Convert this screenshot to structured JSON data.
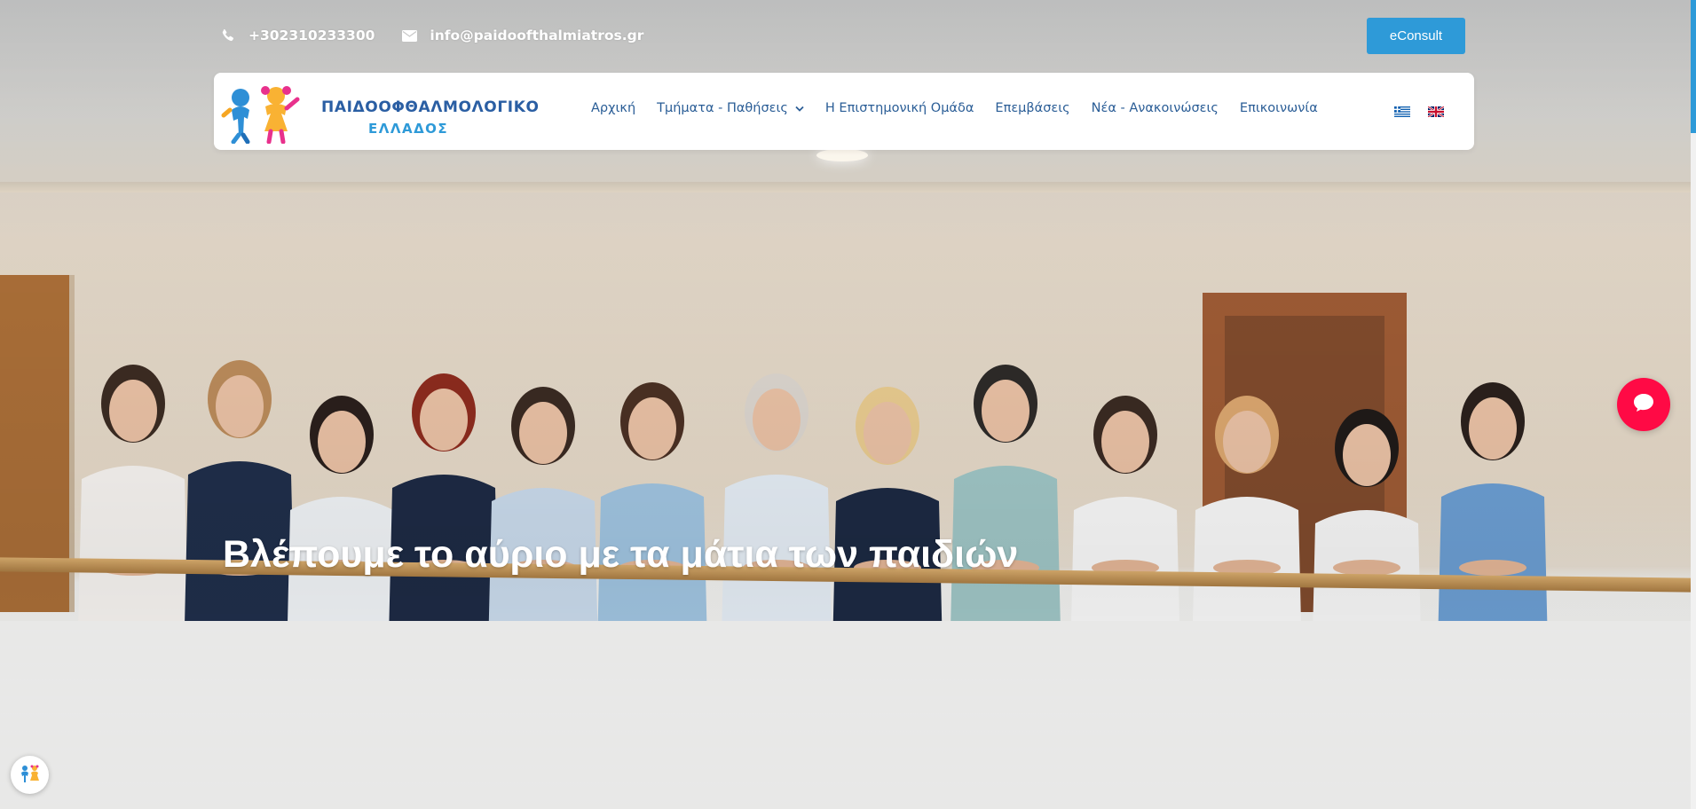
{
  "contact": {
    "phone": "+302310233300",
    "phone_icon": "phone-icon",
    "email": "info@paidoofthalmiatros.gr",
    "email_icon": "envelope-icon"
  },
  "econsult_button": {
    "label": "eConsult",
    "color": "#2e9ad8"
  },
  "logo": {
    "title": "ΠΑΙΔΟΟΦΘΑΛΜΟΛΟΓΙΚΟ",
    "subtitle": "ΕΛΛΑΔΟΣ",
    "title_color": "#2a5ea3",
    "subtitle_color": "#2e9ad8"
  },
  "nav": {
    "items": [
      {
        "label": "Αρχική"
      },
      {
        "label": "Τμήματα - Παθήσεις",
        "has_dropdown": true,
        "icon": "chevron-down-icon"
      },
      {
        "label": "Η Επιστημονική Ομάδα"
      },
      {
        "label": "Επεμβάσεις"
      },
      {
        "label": "Νέα - Ανακοινώσεις"
      },
      {
        "label": "Επικοινωνία"
      }
    ],
    "text_color": "#2a5d96"
  },
  "languages": [
    {
      "code": "el",
      "icon": "greek-flag-icon"
    },
    {
      "code": "en",
      "icon": "uk-flag-icon"
    }
  ],
  "hero": {
    "headline": "Βλέπουμε το αύριο με τα μάτια των παιδιών"
  },
  "chat_widget": {
    "icon": "chat-bubble-icon",
    "color": "#ff0a45"
  },
  "accessibility_widget": {
    "icon": "accessibility-kids-icon"
  }
}
